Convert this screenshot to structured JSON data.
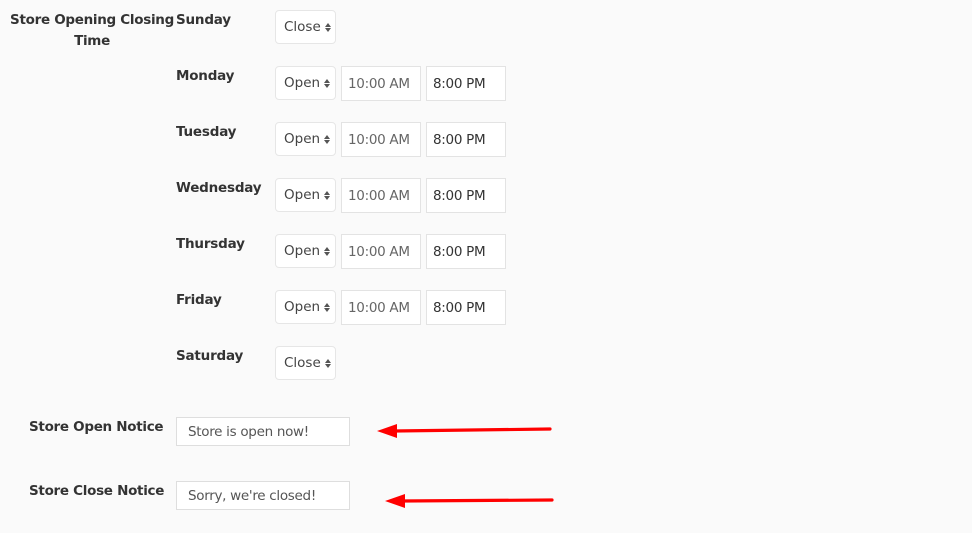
{
  "store_hours": {
    "label": "Store Opening Closing Time",
    "days": [
      {
        "name": "Sunday",
        "status": "Close",
        "open_time": "",
        "close_time": ""
      },
      {
        "name": "Monday",
        "status": "Open",
        "open_time": "10:00 AM",
        "close_time": "8:00 PM"
      },
      {
        "name": "Tuesday",
        "status": "Open",
        "open_time": "10:00 AM",
        "close_time": "8:00 PM"
      },
      {
        "name": "Wednesday",
        "status": "Open",
        "open_time": "10:00 AM",
        "close_time": "8:00 PM"
      },
      {
        "name": "Thursday",
        "status": "Open",
        "open_time": "10:00 AM",
        "close_time": "8:00 PM"
      },
      {
        "name": "Friday",
        "status": "Open",
        "open_time": "10:00 AM",
        "close_time": "8:00 PM"
      },
      {
        "name": "Saturday",
        "status": "Close",
        "open_time": "",
        "close_time": ""
      }
    ]
  },
  "notices": {
    "open": {
      "label": "Store Open Notice",
      "value": "Store is open now!"
    },
    "close": {
      "label": "Store Close Notice",
      "value": "Sorry, we're closed!"
    }
  },
  "annotations": {
    "arrow_color": "#ff0000",
    "arrow_icon": "left-arrow-icon"
  }
}
